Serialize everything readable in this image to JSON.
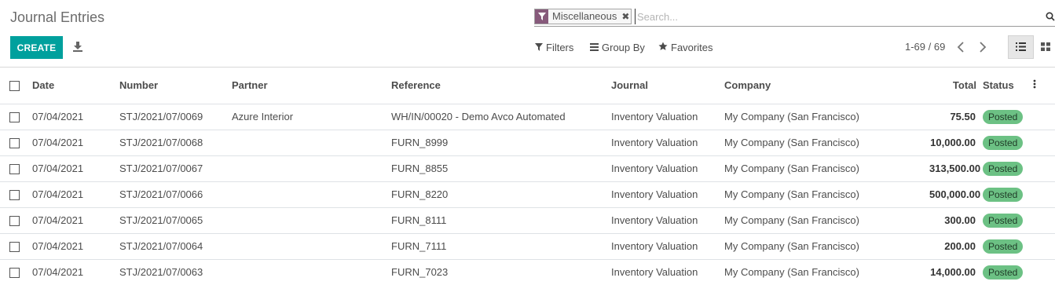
{
  "page": {
    "title": "Journal Entries"
  },
  "toolbar": {
    "create_label": "CREATE"
  },
  "search": {
    "facet_value": "Miscellaneous",
    "facet_remove": "✖",
    "placeholder": "Search..."
  },
  "filters": {
    "filters_label": "Filters",
    "group_by_label": "Group By",
    "favorites_label": "Favorites"
  },
  "pager": {
    "value": "1-69 / 69"
  },
  "table": {
    "columns": {
      "date": "Date",
      "number": "Number",
      "partner": "Partner",
      "reference": "Reference",
      "journal": "Journal",
      "company": "Company",
      "total": "Total",
      "status": "Status"
    },
    "rows": [
      {
        "date": "07/04/2021",
        "number": "STJ/2021/07/0069",
        "partner": "Azure Interior",
        "reference": "WH/IN/00020 - Demo Avco Automated",
        "journal": "Inventory Valuation",
        "company": "My Company (San Francisco)",
        "total": "75.50",
        "status": "Posted"
      },
      {
        "date": "07/04/2021",
        "number": "STJ/2021/07/0068",
        "partner": "",
        "reference": "FURN_8999",
        "journal": "Inventory Valuation",
        "company": "My Company (San Francisco)",
        "total": "10,000.00",
        "status": "Posted"
      },
      {
        "date": "07/04/2021",
        "number": "STJ/2021/07/0067",
        "partner": "",
        "reference": "FURN_8855",
        "journal": "Inventory Valuation",
        "company": "My Company (San Francisco)",
        "total": "313,500.00",
        "status": "Posted"
      },
      {
        "date": "07/04/2021",
        "number": "STJ/2021/07/0066",
        "partner": "",
        "reference": "FURN_8220",
        "journal": "Inventory Valuation",
        "company": "My Company (San Francisco)",
        "total": "500,000.00",
        "status": "Posted"
      },
      {
        "date": "07/04/2021",
        "number": "STJ/2021/07/0065",
        "partner": "",
        "reference": "FURN_8111",
        "journal": "Inventory Valuation",
        "company": "My Company (San Francisco)",
        "total": "300.00",
        "status": "Posted"
      },
      {
        "date": "07/04/2021",
        "number": "STJ/2021/07/0064",
        "partner": "",
        "reference": "FURN_7111",
        "journal": "Inventory Valuation",
        "company": "My Company (San Francisco)",
        "total": "200.00",
        "status": "Posted"
      },
      {
        "date": "07/04/2021",
        "number": "STJ/2021/07/0063",
        "partner": "",
        "reference": "FURN_7023",
        "journal": "Inventory Valuation",
        "company": "My Company (San Francisco)",
        "total": "14,000.00",
        "status": "Posted"
      }
    ]
  },
  "icons": {
    "download": "download-icon",
    "facet": "filter-icon",
    "search": "search-icon",
    "filters": "filter-icon",
    "group_by": "list-icon",
    "favorites": "star-icon",
    "prev": "chevron-left-icon",
    "next": "chevron-right-icon",
    "list_view": "list-view-icon",
    "kanban_view": "kanban-view-icon",
    "optional_columns": "kebab-icon"
  },
  "colors": {
    "primary": "#00a09d",
    "facet_accent": "#875a7b",
    "status_posted": "#6cc184"
  }
}
